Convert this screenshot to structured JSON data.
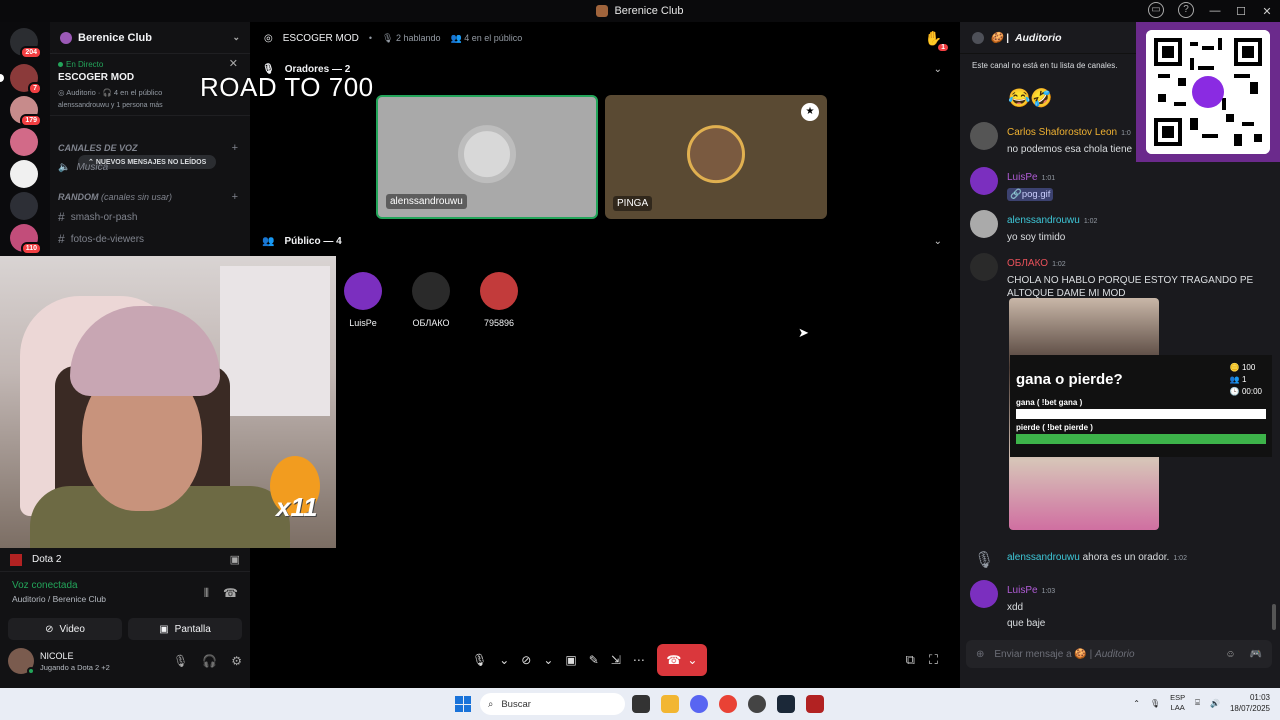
{
  "window": {
    "title": "Berenice Club"
  },
  "rail": {
    "badges": [
      "204",
      "7",
      "179",
      "110"
    ]
  },
  "sidebar": {
    "guild_name": "Berenice Club",
    "live_label": "En Directo",
    "live_title": "ESCOGER MOD",
    "live_channel": "Auditorio",
    "live_audience": "4 en el público",
    "live_people": "alenssandrouwu y 1 persona más",
    "new_messages": "NUEVOS MENSAJES NO LEÍDOS",
    "category_voz": "CANALES DE VOZ",
    "channel_musica": "Musica",
    "category_random": "RANDOM",
    "category_random_note": "(canales sin usar)",
    "channels": [
      "smash-or-pash",
      "fotos-de-viewers"
    ]
  },
  "overlay_text": "ROAD TO 700",
  "stage": {
    "title": "ESCOGER MOD",
    "speaking": "2 hablando",
    "audience": "4 en el público",
    "hand_count": "1",
    "speakers_header": "Oradores — 2",
    "speakers": [
      {
        "name": "alenssandrouwu",
        "color": "#a9a9a9"
      },
      {
        "name": "PINGA",
        "color": "#5a4a33"
      }
    ],
    "audience_header": "Público — 4",
    "audience_members": [
      {
        "name": "LuisPe",
        "color": "#7b2fbf"
      },
      {
        "name": "ОБЛАКО",
        "color": "#2a2a2a"
      },
      {
        "name": "795896",
        "color": "#c23b3b"
      }
    ]
  },
  "user_panel": {
    "game": "Dota 2",
    "voice_status": "Voz conectada",
    "voice_channel": "Auditorio / Berenice Club",
    "video_label": "Video",
    "screen_label": "Pantalla",
    "username": "NICOLE",
    "activity": "Jugando a Dota 2 +2"
  },
  "chat": {
    "channel": "Auditorio",
    "notice": "Este canal no está en tu lista de canales.",
    "messages": [
      {
        "author": "Carlos Shaforostov Leon",
        "time": "1:0",
        "text": "no podemos esa chola tiene",
        "color": "#f0b232"
      },
      {
        "author": "LuisPe",
        "time": "1:01",
        "text": "pog.gif",
        "color": "#b05cd6"
      },
      {
        "author": "alenssandrouwu",
        "time": "1:02",
        "text": "yo soy timido",
        "color": "#3ec7d8"
      },
      {
        "author": "ОБЛАКО",
        "time": "1:02",
        "text": "CHOLA NO HABLO PORQUE ESTOY TRAGANDO PE ALTOQUE DAME MI MOD",
        "color": "#e8515a"
      },
      {
        "author": "alenssandrouwu",
        "time": "1:02",
        "text": "ahora es un orador.",
        "color": "#3ec7d8"
      },
      {
        "author": "LuisPe",
        "time": "1:03",
        "text": "xdd",
        "text2": "que baje",
        "color": "#b05cd6"
      }
    ],
    "composer_placeholder": "Enviar mensaje a",
    "composer_channel": "Auditorio"
  },
  "poll": {
    "question": "gana o pierde?",
    "coins": "100",
    "users": "1",
    "timer": "00:00",
    "option_a": "gana ( !bet gana )",
    "option_b": "pierde ( !bet pierde )"
  },
  "taskbar": {
    "search": "Buscar",
    "lang1": "ESP",
    "lang2": "LAA",
    "time": "01:03",
    "date": "18/07/2025"
  }
}
